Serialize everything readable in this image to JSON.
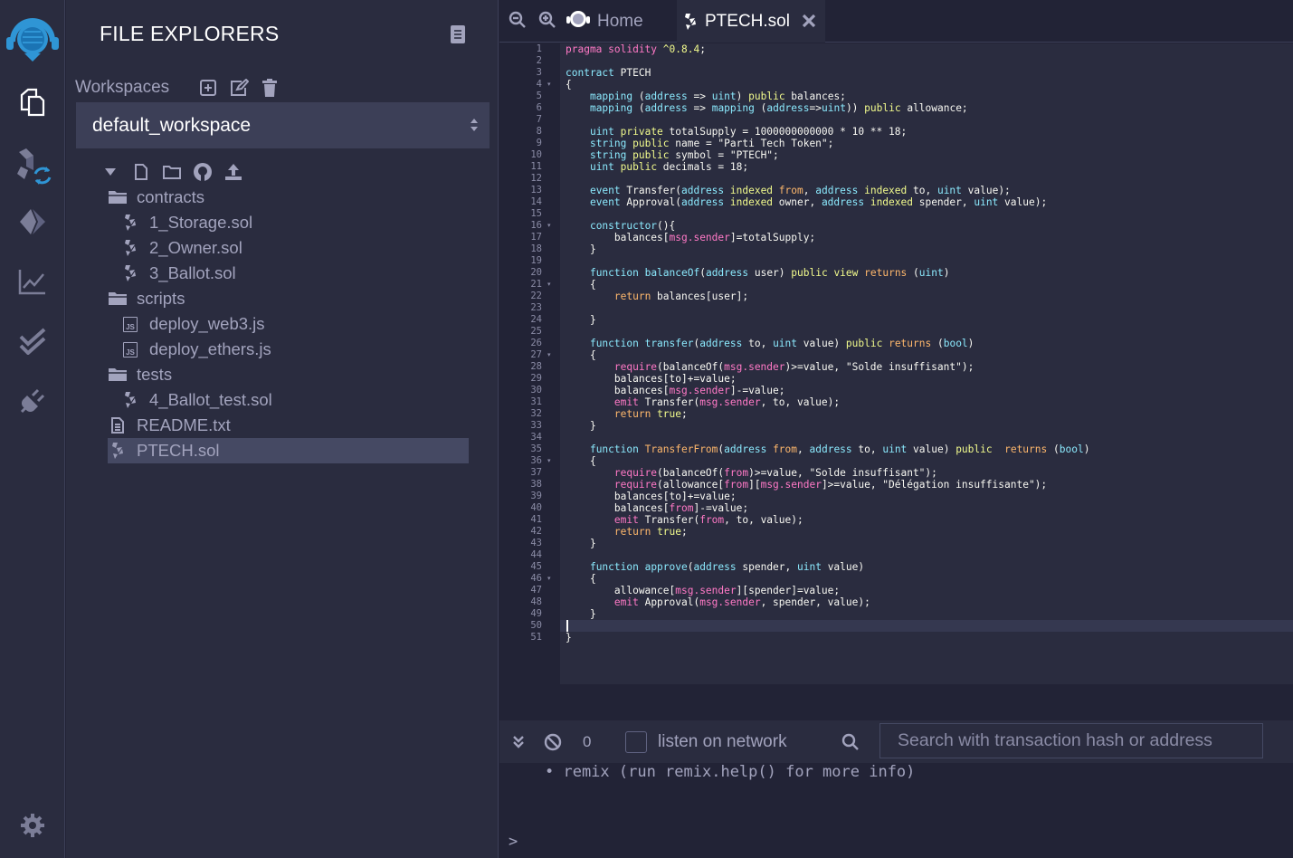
{
  "sidebar": {
    "icons": [
      "remix-logo-icon",
      "file-explorer-icon",
      "solidity-compiler-icon",
      "deploy-run-icon",
      "analytics-icon",
      "verified-icon",
      "plugin-icon",
      "settings-icon"
    ]
  },
  "file_panel": {
    "title": "FILE EXPLORERS",
    "workspaces_label": "Workspaces",
    "workspace_selected": "default_workspace",
    "tree": [
      {
        "label": "contracts",
        "type": "folder",
        "depth": 0
      },
      {
        "label": "1_Storage.sol",
        "type": "sol",
        "depth": 1
      },
      {
        "label": "2_Owner.sol",
        "type": "sol",
        "depth": 1
      },
      {
        "label": "3_Ballot.sol",
        "type": "sol",
        "depth": 1
      },
      {
        "label": "scripts",
        "type": "folder",
        "depth": 0
      },
      {
        "label": "deploy_web3.js",
        "type": "js",
        "depth": 1
      },
      {
        "label": "deploy_ethers.js",
        "type": "js",
        "depth": 1
      },
      {
        "label": "tests",
        "type": "folder",
        "depth": 0
      },
      {
        "label": "4_Ballot_test.sol",
        "type": "sol",
        "depth": 1
      },
      {
        "label": "README.txt",
        "type": "txt",
        "depth": 0
      },
      {
        "label": "PTECH.sol",
        "type": "sol",
        "depth": 0,
        "selected": true
      }
    ],
    "js_badge": "JS"
  },
  "tabs": {
    "home_label": "Home",
    "file_label": "PTECH.sol"
  },
  "editor": {
    "line_numbers": [
      "1",
      "2",
      "3",
      "4",
      "5",
      "6",
      "7",
      "8",
      "9",
      "10",
      "11",
      "12",
      "13",
      "14",
      "15",
      "16",
      "17",
      "18",
      "19",
      "20",
      "21",
      "22",
      "23",
      "24",
      "25",
      "26",
      "27",
      "28",
      "29",
      "30",
      "31",
      "32",
      "33",
      "34",
      "35",
      "36",
      "37",
      "38",
      "39",
      "40",
      "41",
      "42",
      "43",
      "44",
      "45",
      "46",
      "47",
      "48",
      "49",
      "50",
      "51"
    ],
    "folded_lines": [
      4,
      16,
      21,
      27,
      36,
      46
    ],
    "fold_marker": "▾",
    "code": [
      [
        [
          "k",
          "pragma solidity "
        ],
        [
          "y",
          "^0.8.4"
        ],
        [
          "s",
          ";"
        ]
      ],
      [],
      [
        [
          "t",
          "contract "
        ],
        [
          "s",
          "PTECH"
        ]
      ],
      [
        [
          "s",
          "{"
        ]
      ],
      [
        [
          "s",
          "    "
        ],
        [
          "t",
          "mapping "
        ],
        [
          "s",
          "("
        ],
        [
          "t",
          "address"
        ],
        [
          "s",
          " => "
        ],
        [
          "t",
          "uint"
        ],
        [
          "s",
          ") "
        ],
        [
          "y",
          "public"
        ],
        [
          "s",
          " balances;"
        ]
      ],
      [
        [
          "s",
          "    "
        ],
        [
          "t",
          "mapping "
        ],
        [
          "s",
          "("
        ],
        [
          "t",
          "address"
        ],
        [
          "s",
          " => "
        ],
        [
          "t",
          "mapping"
        ],
        [
          "s",
          " ("
        ],
        [
          "t",
          "address"
        ],
        [
          "s",
          "=>"
        ],
        [
          "t",
          "uint"
        ],
        [
          "s",
          ")) "
        ],
        [
          "y",
          "public"
        ],
        [
          "s",
          " allowance;"
        ]
      ],
      [],
      [
        [
          "s",
          "    "
        ],
        [
          "t",
          "uint "
        ],
        [
          "y",
          "private"
        ],
        [
          "s",
          " totalSupply = 1000000000000 * 10 ** 18;"
        ]
      ],
      [
        [
          "s",
          "    "
        ],
        [
          "t",
          "string "
        ],
        [
          "y",
          "public"
        ],
        [
          "s",
          " name = \"Parti Tech Token\";"
        ]
      ],
      [
        [
          "s",
          "    "
        ],
        [
          "t",
          "string "
        ],
        [
          "y",
          "public"
        ],
        [
          "s",
          " symbol = \"PTECH\";"
        ]
      ],
      [
        [
          "s",
          "    "
        ],
        [
          "t",
          "uint "
        ],
        [
          "y",
          "public"
        ],
        [
          "s",
          " decimals = 18;"
        ]
      ],
      [],
      [
        [
          "s",
          "    "
        ],
        [
          "t",
          "event "
        ],
        [
          "s",
          "Transfer("
        ],
        [
          "t",
          "address "
        ],
        [
          "y",
          "indexed"
        ],
        [
          "o",
          " from"
        ],
        [
          "s",
          ", "
        ],
        [
          "t",
          "address "
        ],
        [
          "y",
          "indexed"
        ],
        [
          "s",
          " to, "
        ],
        [
          "t",
          "uint"
        ],
        [
          "s",
          " value);"
        ]
      ],
      [
        [
          "s",
          "    "
        ],
        [
          "t",
          "event "
        ],
        [
          "s",
          "Approval("
        ],
        [
          "t",
          "address "
        ],
        [
          "y",
          "indexed"
        ],
        [
          "s",
          " owner, "
        ],
        [
          "t",
          "address "
        ],
        [
          "y",
          "indexed"
        ],
        [
          "s",
          " spender, "
        ],
        [
          "t",
          "uint"
        ],
        [
          "s",
          " value);"
        ]
      ],
      [],
      [
        [
          "s",
          "    "
        ],
        [
          "t",
          "constructor"
        ],
        [
          "s",
          "(){"
        ]
      ],
      [
        [
          "s",
          "        balances["
        ],
        [
          "k",
          "msg.sender"
        ],
        [
          "s",
          "]=totalSupply;"
        ]
      ],
      [
        [
          "s",
          "    }"
        ]
      ],
      [],
      [
        [
          "s",
          "    "
        ],
        [
          "t",
          "function "
        ],
        [
          "t",
          "balanceOf"
        ],
        [
          "s",
          "("
        ],
        [
          "t",
          "address"
        ],
        [
          "s",
          " user) "
        ],
        [
          "y",
          "public"
        ],
        [
          "s",
          " "
        ],
        [
          "y",
          "view"
        ],
        [
          "s",
          " "
        ],
        [
          "o",
          "returns"
        ],
        [
          "s",
          " ("
        ],
        [
          "t",
          "uint"
        ],
        [
          "s",
          ")"
        ]
      ],
      [
        [
          "s",
          "    {"
        ]
      ],
      [
        [
          "s",
          "        "
        ],
        [
          "o",
          "return"
        ],
        [
          "s",
          " balances[user];"
        ]
      ],
      [],
      [
        [
          "s",
          "    }"
        ]
      ],
      [],
      [
        [
          "s",
          "    "
        ],
        [
          "t",
          "function "
        ],
        [
          "t",
          "transfer"
        ],
        [
          "s",
          "("
        ],
        [
          "t",
          "address"
        ],
        [
          "s",
          " to, "
        ],
        [
          "t",
          "uint"
        ],
        [
          "s",
          " value) "
        ],
        [
          "y",
          "public"
        ],
        [
          "s",
          " "
        ],
        [
          "o",
          "returns"
        ],
        [
          "s",
          " ("
        ],
        [
          "t",
          "bool"
        ],
        [
          "s",
          ")"
        ]
      ],
      [
        [
          "s",
          "    {"
        ]
      ],
      [
        [
          "s",
          "        "
        ],
        [
          "k",
          "require"
        ],
        [
          "s",
          "(balanceOf("
        ],
        [
          "k",
          "msg.sender"
        ],
        [
          "s",
          ")>=value, \"Solde insuffisant\");"
        ]
      ],
      [
        [
          "s",
          "        balances[to]+=value;"
        ]
      ],
      [
        [
          "s",
          "        balances["
        ],
        [
          "k",
          "msg.sender"
        ],
        [
          "s",
          "]-=value;"
        ]
      ],
      [
        [
          "s",
          "        "
        ],
        [
          "k",
          "emit"
        ],
        [
          "s",
          " Transfer("
        ],
        [
          "k",
          "msg.sender"
        ],
        [
          "s",
          ", to, value);"
        ]
      ],
      [
        [
          "s",
          "        "
        ],
        [
          "o",
          "return"
        ],
        [
          "s",
          " "
        ],
        [
          "y",
          "true"
        ],
        [
          "s",
          ";"
        ]
      ],
      [
        [
          "s",
          "    }"
        ]
      ],
      [],
      [
        [
          "s",
          "    "
        ],
        [
          "t",
          "function "
        ],
        [
          "o",
          "TransferFrom"
        ],
        [
          "s",
          "("
        ],
        [
          "t",
          "address"
        ],
        [
          "s",
          " "
        ],
        [
          "o",
          "from"
        ],
        [
          "s",
          ", "
        ],
        [
          "t",
          "address"
        ],
        [
          "s",
          " to, "
        ],
        [
          "t",
          "uint"
        ],
        [
          "s",
          " value) "
        ],
        [
          "y",
          "public"
        ],
        [
          "s",
          "  "
        ],
        [
          "o",
          "returns"
        ],
        [
          "s",
          " ("
        ],
        [
          "t",
          "bool"
        ],
        [
          "s",
          ")"
        ]
      ],
      [
        [
          "s",
          "    {"
        ]
      ],
      [
        [
          "s",
          "        "
        ],
        [
          "k",
          "require"
        ],
        [
          "s",
          "(balanceOf("
        ],
        [
          "k",
          "from"
        ],
        [
          "s",
          ")>=value, \"Solde insuffisant\");"
        ]
      ],
      [
        [
          "s",
          "        "
        ],
        [
          "k",
          "require"
        ],
        [
          "s",
          "(allowance["
        ],
        [
          "k",
          "from"
        ],
        [
          "s",
          "]["
        ],
        [
          "k",
          "msg.sender"
        ],
        [
          "s",
          "]>=value, \"Délégation insuffisante\");"
        ]
      ],
      [
        [
          "s",
          "        balances[to]+=value;"
        ]
      ],
      [
        [
          "s",
          "        balances["
        ],
        [
          "k",
          "from"
        ],
        [
          "s",
          "]-=value;"
        ]
      ],
      [
        [
          "s",
          "        "
        ],
        [
          "k",
          "emit"
        ],
        [
          "s",
          " Transfer("
        ],
        [
          "k",
          "from"
        ],
        [
          "s",
          ", to, value);"
        ]
      ],
      [
        [
          "s",
          "        "
        ],
        [
          "o",
          "return"
        ],
        [
          "s",
          " "
        ],
        [
          "y",
          "true"
        ],
        [
          "s",
          ";"
        ]
      ],
      [
        [
          "s",
          "    }"
        ]
      ],
      [],
      [
        [
          "s",
          "    "
        ],
        [
          "t",
          "function "
        ],
        [
          "t",
          "approve"
        ],
        [
          "s",
          "("
        ],
        [
          "t",
          "address"
        ],
        [
          "s",
          " spender, "
        ],
        [
          "t",
          "uint"
        ],
        [
          "s",
          " value)"
        ]
      ],
      [
        [
          "s",
          "    {"
        ]
      ],
      [
        [
          "s",
          "        allowance["
        ],
        [
          "k",
          "msg.sender"
        ],
        [
          "s",
          "][spender]=value;"
        ]
      ],
      [
        [
          "s",
          "        "
        ],
        [
          "k",
          "emit"
        ],
        [
          "s",
          " Approval("
        ],
        [
          "k",
          "msg.sender"
        ],
        [
          "s",
          ", spender, value);"
        ]
      ],
      [
        [
          "s",
          "    }"
        ]
      ],
      [],
      [
        [
          "s",
          "}"
        ]
      ]
    ]
  },
  "terminal": {
    "count": "0",
    "listen_label": "listen on network",
    "search_placeholder": "Search with transaction hash or address",
    "log_line": "• remix (run remix.help() for more info)",
    "prompt": ">"
  },
  "colors": {
    "background": "#222336",
    "panel": "#2a2c3f",
    "selection": "#454963",
    "accent": "#2f95d5"
  }
}
